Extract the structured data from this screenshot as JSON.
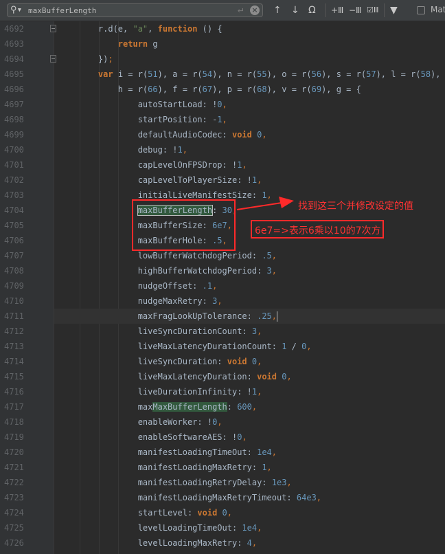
{
  "search": {
    "query": "maxBufferLength",
    "match_label": "Mat"
  },
  "toolbar_icons": [
    "search-icon",
    "enter-icon",
    "clear-icon",
    "arrow-up-icon",
    "arrow-down-icon",
    "find-all-icon",
    "add-selection-icon",
    "remove-selection-icon",
    "select-all-occurrences-icon",
    "filter-icon"
  ],
  "annotations": {
    "callout": "找到这三个并修改设定的值",
    "note": "6e7=>表示6乘以10的7次方",
    "color": "#ff2a2a"
  },
  "current_line": 4711,
  "lines": [
    {
      "num": "4692",
      "tokens": [
        [
          "t",
          "    r.d(e, "
        ],
        [
          "s",
          "\"a\""
        ],
        [
          "t",
          ", "
        ],
        [
          "k",
          "function"
        ],
        [
          "t",
          " () {"
        ]
      ]
    },
    {
      "num": "4693",
      "tokens": [
        [
          "t",
          "        "
        ],
        [
          "k",
          "return"
        ],
        [
          "t",
          " g"
        ]
      ]
    },
    {
      "num": "4694",
      "tokens": [
        [
          "t",
          "    })"
        ],
        [
          "p",
          ";"
        ]
      ]
    },
    {
      "num": "4695",
      "tokens": [
        [
          "t",
          "    "
        ],
        [
          "k",
          "var"
        ],
        [
          "t",
          " i = r("
        ],
        [
          "n",
          "51"
        ],
        [
          "t",
          "), a = r("
        ],
        [
          "n",
          "54"
        ],
        [
          "t",
          "), n = r("
        ],
        [
          "n",
          "55"
        ],
        [
          "t",
          "), o = r("
        ],
        [
          "n",
          "56"
        ],
        [
          "t",
          "), s = r("
        ],
        [
          "n",
          "57"
        ],
        [
          "t",
          "), l = r("
        ],
        [
          "n",
          "58"
        ],
        [
          "t",
          "), u"
        ]
      ]
    },
    {
      "num": "4696",
      "tokens": [
        [
          "t",
          "        h = r("
        ],
        [
          "n",
          "66"
        ],
        [
          "t",
          "), f = r("
        ],
        [
          "n",
          "67"
        ],
        [
          "t",
          "), p = r("
        ],
        [
          "n",
          "68"
        ],
        [
          "t",
          "), v = r("
        ],
        [
          "n",
          "69"
        ],
        [
          "t",
          "), g = {"
        ]
      ]
    },
    {
      "num": "4697",
      "tokens": [
        [
          "t",
          "            autoStartLoad: !"
        ],
        [
          "n",
          "0"
        ],
        [
          "p",
          ","
        ]
      ]
    },
    {
      "num": "4698",
      "tokens": [
        [
          "t",
          "            startPosition: -"
        ],
        [
          "n",
          "1"
        ],
        [
          "p",
          ","
        ]
      ]
    },
    {
      "num": "4699",
      "tokens": [
        [
          "t",
          "            defaultAudioCodec: "
        ],
        [
          "k",
          "void"
        ],
        [
          "t",
          " "
        ],
        [
          "n",
          "0"
        ],
        [
          "p",
          ","
        ]
      ]
    },
    {
      "num": "4700",
      "tokens": [
        [
          "t",
          "            debug: !"
        ],
        [
          "n",
          "1"
        ],
        [
          "p",
          ","
        ]
      ]
    },
    {
      "num": "4701",
      "tokens": [
        [
          "t",
          "            capLevelOnFPSDrop: !"
        ],
        [
          "n",
          "1"
        ],
        [
          "p",
          ","
        ]
      ]
    },
    {
      "num": "4702",
      "tokens": [
        [
          "t",
          "            capLevelToPlayerSize: !"
        ],
        [
          "n",
          "1"
        ],
        [
          "p",
          ","
        ]
      ]
    },
    {
      "num": "4703",
      "tokens": [
        [
          "t",
          "            initialLiveManifestSize: "
        ],
        [
          "n",
          "1"
        ],
        [
          "p",
          ","
        ]
      ]
    },
    {
      "num": "4704",
      "tokens": [
        [
          "t",
          "            "
        ],
        [
          "msel",
          "maxBufferLength"
        ],
        [
          "t",
          ": "
        ],
        [
          "n",
          "30"
        ],
        [
          "p",
          ","
        ]
      ]
    },
    {
      "num": "4705",
      "tokens": [
        [
          "t",
          "            maxBufferSize: "
        ],
        [
          "n",
          "6e7"
        ],
        [
          "p",
          ","
        ]
      ]
    },
    {
      "num": "4706",
      "tokens": [
        [
          "t",
          "            maxBufferHole: "
        ],
        [
          "n",
          ".5"
        ],
        [
          "p",
          ","
        ]
      ]
    },
    {
      "num": "4707",
      "tokens": [
        [
          "t",
          "            lowBufferWatchdogPeriod: "
        ],
        [
          "n",
          ".5"
        ],
        [
          "p",
          ","
        ]
      ]
    },
    {
      "num": "4708",
      "tokens": [
        [
          "t",
          "            highBufferWatchdogPeriod: "
        ],
        [
          "n",
          "3"
        ],
        [
          "p",
          ","
        ]
      ]
    },
    {
      "num": "4709",
      "tokens": [
        [
          "t",
          "            nudgeOffset: "
        ],
        [
          "n",
          ".1"
        ],
        [
          "p",
          ","
        ]
      ]
    },
    {
      "num": "4710",
      "tokens": [
        [
          "t",
          "            nudgeMaxRetry: "
        ],
        [
          "n",
          "3"
        ],
        [
          "p",
          ","
        ]
      ]
    },
    {
      "num": "4711",
      "tokens": [
        [
          "t",
          "            maxFragLookUpTolerance: "
        ],
        [
          "n",
          ".25"
        ],
        [
          "p",
          ","
        ],
        [
          "caret",
          ""
        ]
      ]
    },
    {
      "num": "4712",
      "tokens": [
        [
          "t",
          "            liveSyncDurationCount: "
        ],
        [
          "n",
          "3"
        ],
        [
          "p",
          ","
        ]
      ]
    },
    {
      "num": "4713",
      "tokens": [
        [
          "t",
          "            liveMaxLatencyDurationCount: "
        ],
        [
          "n",
          "1"
        ],
        [
          "t",
          " / "
        ],
        [
          "n",
          "0"
        ],
        [
          "p",
          ","
        ]
      ]
    },
    {
      "num": "4714",
      "tokens": [
        [
          "t",
          "            liveSyncDuration: "
        ],
        [
          "k",
          "void"
        ],
        [
          "t",
          " "
        ],
        [
          "n",
          "0"
        ],
        [
          "p",
          ","
        ]
      ]
    },
    {
      "num": "4715",
      "tokens": [
        [
          "t",
          "            liveMaxLatencyDuration: "
        ],
        [
          "k",
          "void"
        ],
        [
          "t",
          " "
        ],
        [
          "n",
          "0"
        ],
        [
          "p",
          ","
        ]
      ]
    },
    {
      "num": "4716",
      "tokens": [
        [
          "t",
          "            liveDurationInfinity: !"
        ],
        [
          "n",
          "1"
        ],
        [
          "p",
          ","
        ]
      ]
    },
    {
      "num": "4717",
      "tokens": [
        [
          "t",
          "            max"
        ],
        [
          "m",
          "MaxBufferLength"
        ],
        [
          "t",
          ": "
        ],
        [
          "n",
          "600"
        ],
        [
          "p",
          ","
        ]
      ]
    },
    {
      "num": "4718",
      "tokens": [
        [
          "t",
          "            enableWorker: !"
        ],
        [
          "n",
          "0"
        ],
        [
          "p",
          ","
        ]
      ]
    },
    {
      "num": "4719",
      "tokens": [
        [
          "t",
          "            enableSoftwareAES: !"
        ],
        [
          "n",
          "0"
        ],
        [
          "p",
          ","
        ]
      ]
    },
    {
      "num": "4720",
      "tokens": [
        [
          "t",
          "            manifestLoadingTimeOut: "
        ],
        [
          "n",
          "1e4"
        ],
        [
          "p",
          ","
        ]
      ]
    },
    {
      "num": "4721",
      "tokens": [
        [
          "t",
          "            manifestLoadingMaxRetry: "
        ],
        [
          "n",
          "1"
        ],
        [
          "p",
          ","
        ]
      ]
    },
    {
      "num": "4722",
      "tokens": [
        [
          "t",
          "            manifestLoadingRetryDelay: "
        ],
        [
          "n",
          "1e3"
        ],
        [
          "p",
          ","
        ]
      ]
    },
    {
      "num": "4723",
      "tokens": [
        [
          "t",
          "            manifestLoadingMaxRetryTimeout: "
        ],
        [
          "n",
          "64e3"
        ],
        [
          "p",
          ","
        ]
      ]
    },
    {
      "num": "4724",
      "tokens": [
        [
          "t",
          "            startLevel: "
        ],
        [
          "k",
          "void"
        ],
        [
          "t",
          " "
        ],
        [
          "n",
          "0"
        ],
        [
          "p",
          ","
        ]
      ]
    },
    {
      "num": "4725",
      "tokens": [
        [
          "t",
          "            levelLoadingTimeOut: "
        ],
        [
          "n",
          "1e4"
        ],
        [
          "p",
          ","
        ]
      ]
    },
    {
      "num": "4726",
      "tokens": [
        [
          "t",
          "            levelLoadingMaxRetry: "
        ],
        [
          "n",
          "4"
        ],
        [
          "p",
          ","
        ]
      ]
    }
  ]
}
